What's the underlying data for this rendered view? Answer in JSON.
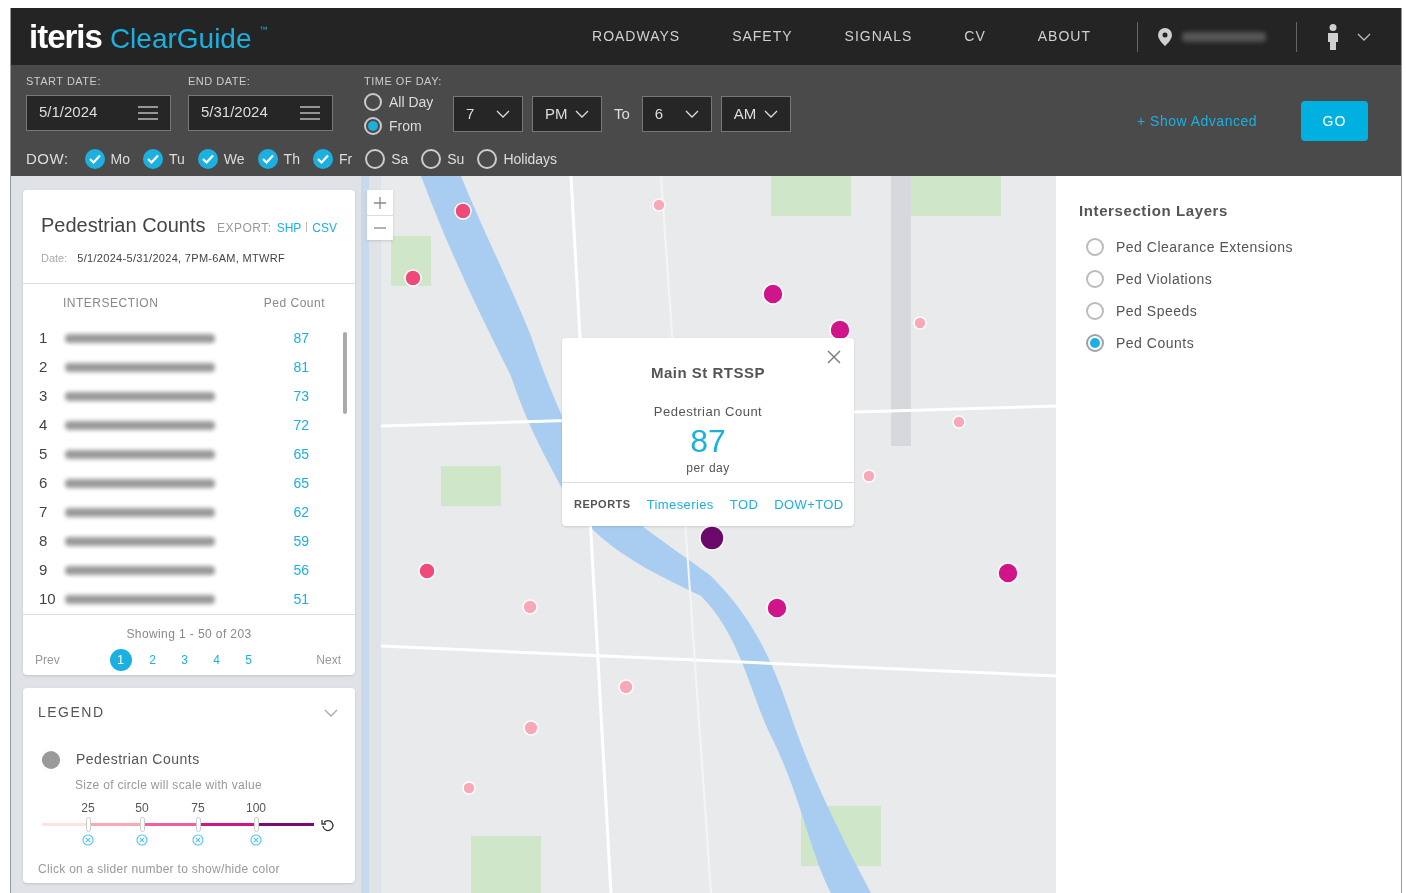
{
  "logo": {
    "brand": "iteris",
    "product": "ClearGuide",
    "mark": "™"
  },
  "nav": [
    {
      "label": "ROADWAYS",
      "selected": false
    },
    {
      "label": "SAFETY",
      "selected": false
    },
    {
      "label": "SIGNALS",
      "selected": false
    },
    {
      "label": "CV",
      "selected": false
    },
    {
      "label": "ABOUT",
      "selected": false
    }
  ],
  "filters": {
    "start_label": "START DATE:",
    "start_value": "5/1/2024",
    "end_label": "END DATE:",
    "end_value": "5/31/2024",
    "tod_label": "TIME OF DAY:",
    "tod_options": [
      {
        "label": "All Day",
        "selected": false
      },
      {
        "label": "From",
        "selected": true
      }
    ],
    "from_hour": "7",
    "from_ampm": "PM",
    "to_label": "To",
    "to_hour": "6",
    "to_ampm": "AM",
    "dow_label": "DOW:",
    "days": [
      {
        "label": "Mo",
        "checked": true
      },
      {
        "label": "Tu",
        "checked": true
      },
      {
        "label": "We",
        "checked": true
      },
      {
        "label": "Th",
        "checked": true
      },
      {
        "label": "Fr",
        "checked": true
      },
      {
        "label": "Sa",
        "checked": false
      },
      {
        "label": "Su",
        "checked": false
      },
      {
        "label": "Holidays",
        "checked": false
      }
    ],
    "advanced": "+ Show Advanced",
    "go": "GO"
  },
  "panel": {
    "title": "Pedestrian Counts",
    "export_label": "EXPORT:",
    "export_links": [
      "SHP",
      "CSV"
    ],
    "date_label": "Date:",
    "date_value": "5/1/2024-5/31/2024, 7PM-6AM, MTWRF",
    "columns": [
      "INTERSECTION",
      "Ped Count"
    ],
    "rows": [
      {
        "rank": "1",
        "count": "87"
      },
      {
        "rank": "2",
        "count": "81"
      },
      {
        "rank": "3",
        "count": "73"
      },
      {
        "rank": "4",
        "count": "72"
      },
      {
        "rank": "5",
        "count": "65"
      },
      {
        "rank": "6",
        "count": "65"
      },
      {
        "rank": "7",
        "count": "62"
      },
      {
        "rank": "8",
        "count": "59"
      },
      {
        "rank": "9",
        "count": "56"
      },
      {
        "rank": "10",
        "count": "51"
      }
    ],
    "showing": "Showing 1 - 50 of 203",
    "prev": "Prev",
    "next": "Next",
    "pages": [
      {
        "label": "1",
        "selected": true
      },
      {
        "label": "2",
        "selected": false
      },
      {
        "label": "3",
        "selected": false
      },
      {
        "label": "4",
        "selected": false
      },
      {
        "label": "5",
        "selected": false
      }
    ]
  },
  "legend": {
    "title": "LEGEND",
    "layer": "Pedestrian Counts",
    "note": "Size of circle will scale with value",
    "stops": [
      {
        "label": "25",
        "color": "#f9a8b8"
      },
      {
        "label": "50",
        "color": "#f0609a"
      },
      {
        "label": "75",
        "color": "#d0158a"
      },
      {
        "label": "100",
        "color": "#7a0a78"
      }
    ],
    "hint": "Click on a slider number to show/hide color"
  },
  "popup": {
    "title": "Main St RTSSP",
    "metric": "Pedestrian Count",
    "value": "87",
    "unit": "per day",
    "reports_label": "REPORTS",
    "reports": [
      "Timeseries",
      "TOD",
      "DOW+TOD"
    ]
  },
  "layers": {
    "title": "Intersection Layers",
    "items": [
      {
        "label": "Ped Clearance Extensions",
        "selected": false
      },
      {
        "label": "Ped Violations",
        "selected": false
      },
      {
        "label": "Ped Speeds",
        "selected": false
      },
      {
        "label": "Ped Counts",
        "selected": true
      }
    ]
  }
}
